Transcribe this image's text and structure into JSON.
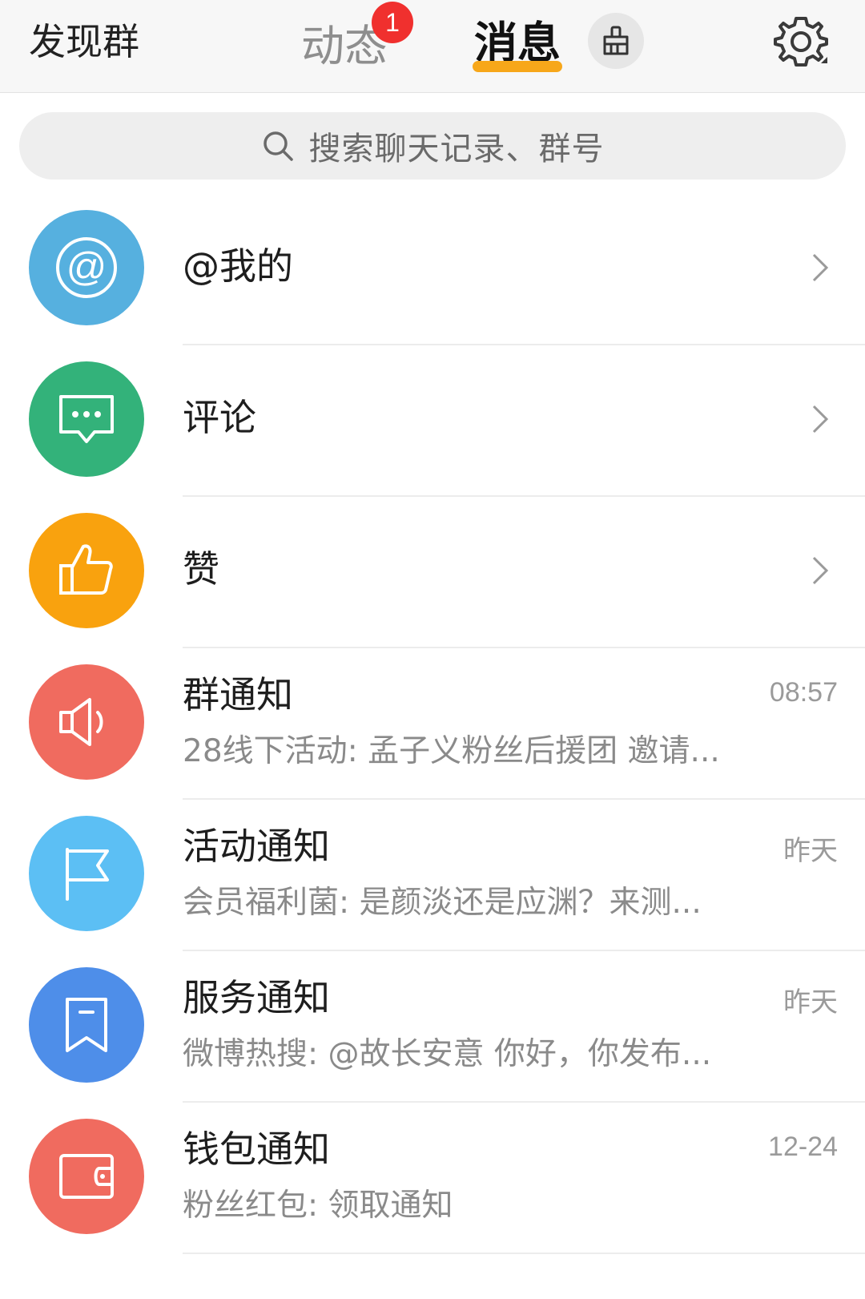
{
  "header": {
    "discover_label": "发现群",
    "tab_dongtai": "动态",
    "tab_dongtai_badge": "1",
    "tab_xiaoxi": "消息",
    "active_tab_color": "#f7a71a"
  },
  "search": {
    "placeholder": "搜索聊天记录、群号"
  },
  "list": {
    "items": [
      {
        "title": "@我的",
        "subtitle": "",
        "time": "",
        "icon": "at-icon",
        "color": "#56b0df",
        "has_chevron": true
      },
      {
        "title": "评论",
        "subtitle": "",
        "time": "",
        "icon": "comment-icon",
        "color": "#33b27a",
        "has_chevron": true
      },
      {
        "title": "赞",
        "subtitle": "",
        "time": "",
        "icon": "thumbs-up-icon",
        "color": "#f9a20e",
        "has_chevron": true
      },
      {
        "title": "群通知",
        "subtitle": "28线下活动: 孟子义粉丝后援团 邀请...",
        "time": "08:57",
        "icon": "megaphone-icon",
        "color": "#f06b5f",
        "has_chevron": false
      },
      {
        "title": "活动通知",
        "subtitle": "会员福利菌: 是颜淡还是应渊？来测...",
        "time": "昨天",
        "icon": "flag-icon",
        "color": "#5cbff4",
        "has_chevron": false
      },
      {
        "title": "服务通知",
        "subtitle": "微博热搜: @故长安意 你好，你发布...",
        "time": "昨天",
        "icon": "bookmark-icon",
        "color": "#4e8ee9",
        "has_chevron": false
      },
      {
        "title": "钱包通知",
        "subtitle": "粉丝红包: 领取通知",
        "time": "12-24",
        "icon": "wallet-icon",
        "color": "#f06b5f",
        "has_chevron": false
      }
    ]
  }
}
